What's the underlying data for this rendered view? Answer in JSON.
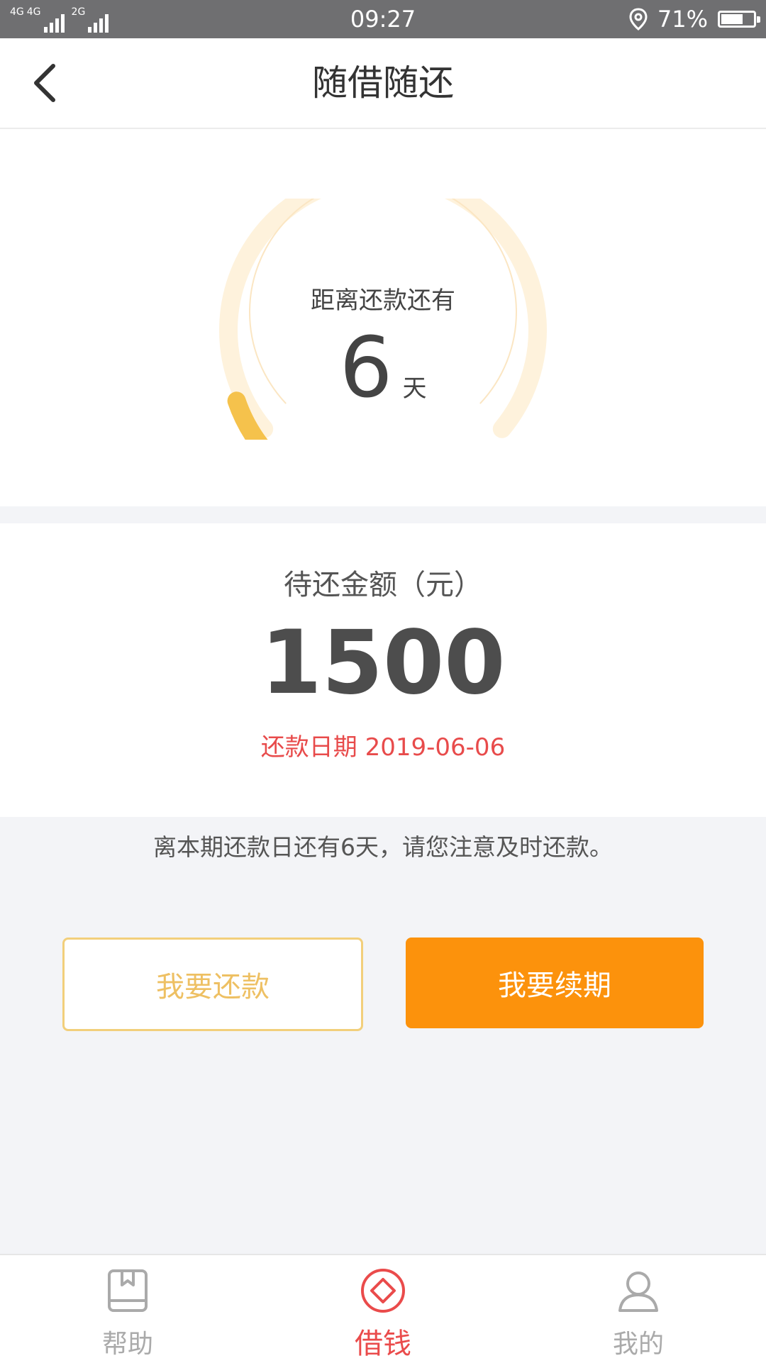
{
  "status_bar": {
    "network_1": "4G",
    "network_2": "4G",
    "network_3": "2G",
    "time": "09:27",
    "battery": "71%",
    "battery_level": 0.71
  },
  "header": {
    "title": "随借随还"
  },
  "countdown": {
    "caption": "距离还款还有",
    "days": "6",
    "unit": "天",
    "progress": 0.12,
    "colors": {
      "track": "#fef2dc",
      "inner_ring": "#fbe6c3",
      "progress": "#f5c24c"
    }
  },
  "amount": {
    "label": "待还金额（元）",
    "value": "1500",
    "due_date_text": "还款日期 2019-06-06"
  },
  "notice": "离本期还款日还有6天，请您注意及时还款。",
  "actions": {
    "repay_label": "我要还款",
    "renew_label": "我要续期"
  },
  "tabs": [
    {
      "label": "帮助",
      "icon": "book-icon",
      "active": false
    },
    {
      "label": "借钱",
      "icon": "diamond-icon",
      "active": true
    },
    {
      "label": "我的",
      "icon": "user-icon",
      "active": false
    }
  ],
  "colors": {
    "accent": "#fc920c",
    "danger": "#e84b4b",
    "tab_active": "#ea4b4b",
    "tab_inactive": "#aaaaaa"
  }
}
